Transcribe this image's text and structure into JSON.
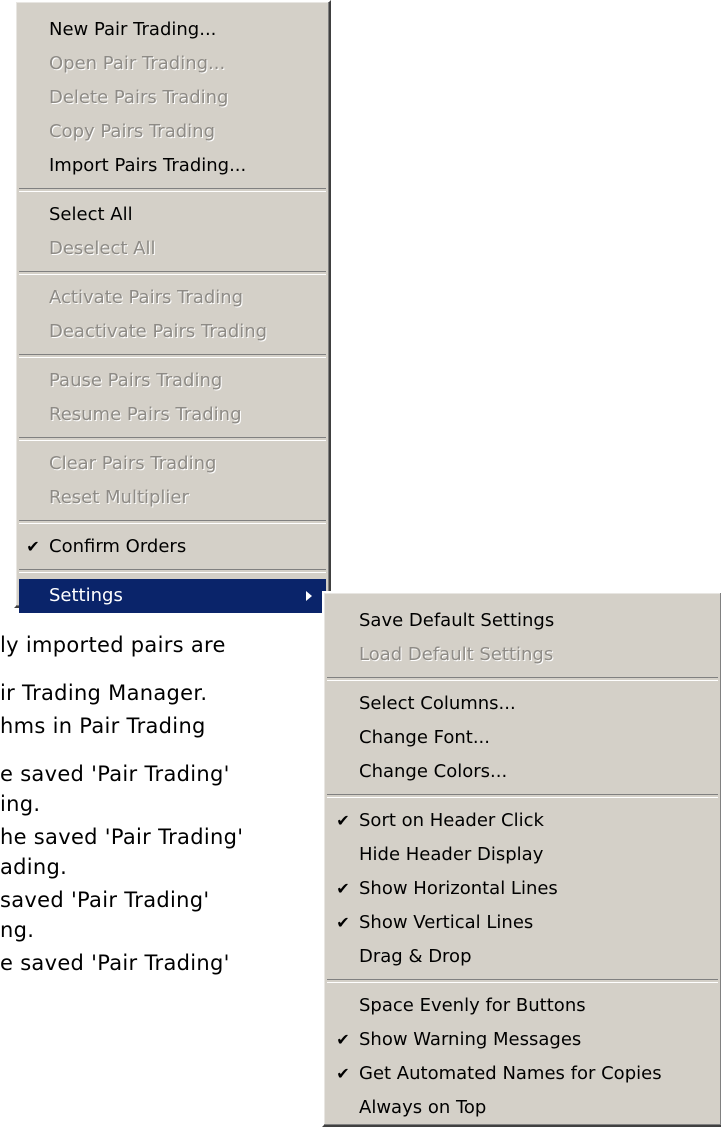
{
  "background_text": [
    "ly imported pairs are",
    "ir Trading Manager.",
    "hms in Pair Trading",
    "e saved 'Pair Trading'",
    "ing.",
    "he saved 'Pair Trading'",
    "ading.",
    " saved 'Pair Trading'",
    "ng.",
    "e saved 'Pair Trading'"
  ],
  "main_menu": {
    "new_pair": "New Pair Trading...",
    "open_pair": "Open Pair Trading...",
    "delete_pairs": "Delete Pairs Trading",
    "copy_pairs": "Copy Pairs Trading",
    "import_pairs": "Import Pairs Trading...",
    "select_all": "Select All",
    "deselect_all": "Deselect All",
    "activate": "Activate Pairs Trading",
    "deactivate": "Deactivate Pairs Trading",
    "pause": "Pause Pairs Trading",
    "resume": "Resume Pairs Trading",
    "clear": "Clear Pairs Trading",
    "reset_multiplier": "Reset Multiplier",
    "confirm_orders": "Confirm Orders",
    "settings": "Settings"
  },
  "settings_menu": {
    "save_default": "Save Default Settings",
    "load_default": "Load Default Settings",
    "select_columns": "Select Columns...",
    "change_font": "Change Font...",
    "change_colors": "Change Colors...",
    "sort_header": "Sort on Header Click",
    "hide_header": "Hide Header Display",
    "horizontal_lines": "Show Horizontal Lines",
    "vertical_lines": "Show Vertical Lines",
    "drag_drop": "Drag & Drop",
    "space_evenly": "Space Evenly for Buttons",
    "warning_messages": "Show Warning Messages",
    "automated_names": "Get Automated Names for Copies",
    "always_on_top": "Always on Top"
  },
  "checkmark": "✔",
  "colors": {
    "menu_bg": "#d4d0c8",
    "highlight": "#0a246a",
    "disabled_text": "#8e8b86"
  }
}
